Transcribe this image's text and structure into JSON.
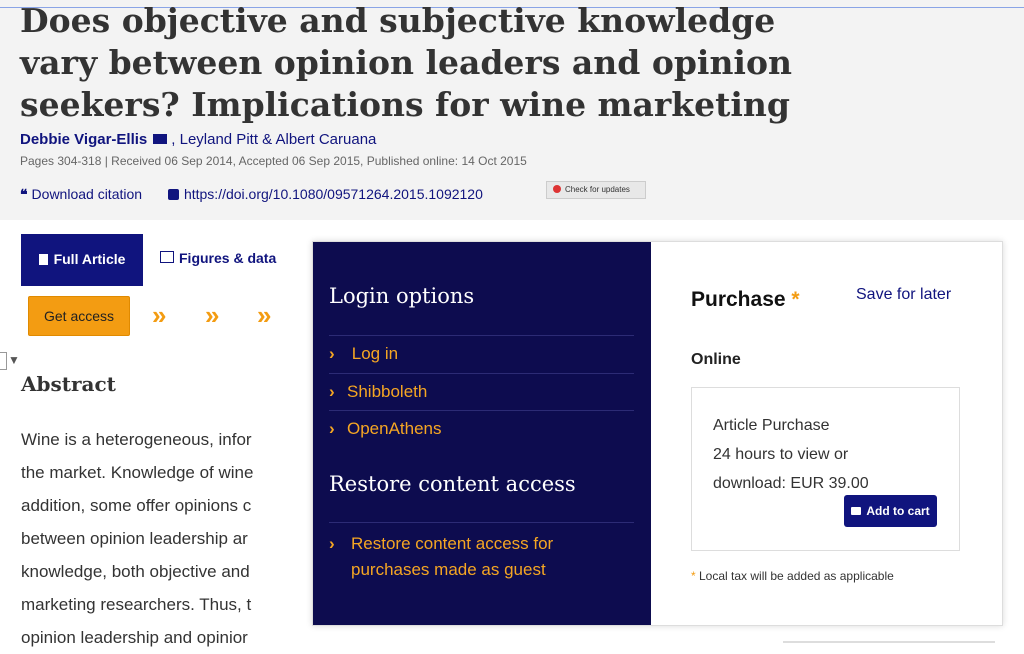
{
  "article": {
    "title": "Does objective and subjective knowledge vary between opinion leaders and opinion seekers? Implications for wine marketing",
    "author_lead": "Debbie Vigar-Ellis",
    "authors_rest": ", Leyland Pitt & Albert Caruana",
    "meta": "Pages 304-318 | Received 06 Sep 2014, Accepted 06 Sep 2015, Published online: 14 Oct 2015",
    "download_citation": "Download citation",
    "doi": "https://doi.org/10.1080/09571264.2015.1092120",
    "check_updates": "Check for updates"
  },
  "tabs": {
    "full_article": "Full Article",
    "figures_data": "Figures & data"
  },
  "get_access": "Get access",
  "abstract": {
    "heading": "Abstract",
    "lines": [
      "Wine is a heterogeneous, infor",
      "the market. Knowledge of wine",
      "addition, some offer opinions c",
      "between opinion leadership ar",
      "knowledge, both objective and",
      "marketing researchers. Thus, t",
      "opinion leadership and opinior"
    ]
  },
  "login_panel": {
    "title": "Login options",
    "items": [
      "Log in",
      "Shibboleth",
      "OpenAthens"
    ],
    "restore_title": "Restore content access",
    "restore_link": "Restore content access for purchases made as guest"
  },
  "purchase": {
    "title": "Purchase",
    "star": "*",
    "save_later": "Save for later",
    "online": "Online",
    "box_lines": [
      "Article Purchase",
      "24 hours to view or",
      "download: EUR 39.00"
    ],
    "add_to_cart": "Add to cart",
    "tax_star": "*",
    "tax_note": " Local tax will be added as applicable"
  },
  "colors": {
    "navy": "#10147e",
    "login_bg": "#0d0c4f",
    "accent_orange": "#f39c12"
  }
}
